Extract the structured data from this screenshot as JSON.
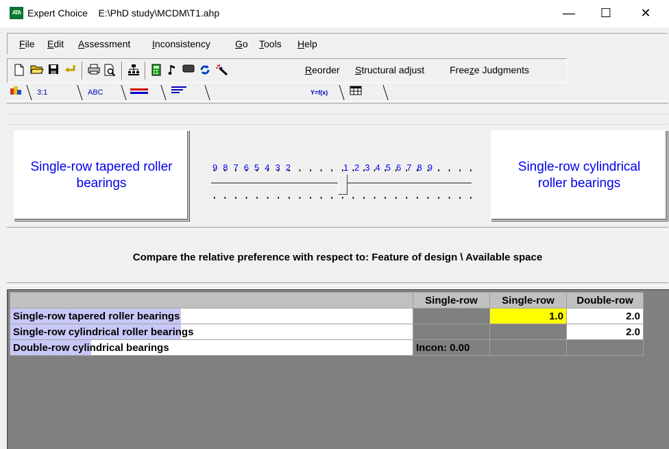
{
  "window": {
    "app_icon_text": "ATA",
    "title": "Expert Choice    E:\\PhD study\\MCDM\\T1.ahp",
    "minimize": "—",
    "maximize": "☐",
    "close": "✕"
  },
  "menu": {
    "file": {
      "key": "F",
      "rest": "ile"
    },
    "edit": {
      "key": "E",
      "rest": "dit"
    },
    "assessment": {
      "key": "A",
      "rest": "ssessment"
    },
    "inconsistency": {
      "key": "I",
      "rest": "nconsistency"
    },
    "go": {
      "key": "G",
      "rest": "o"
    },
    "tools": {
      "key": "T",
      "rest": "ools"
    },
    "help": {
      "key": "H",
      "rest": "elp"
    }
  },
  "toolbar": {
    "reorder": {
      "key": "R",
      "rest": "eorder"
    },
    "structural": {
      "key": "S",
      "rest": "tructural adjust"
    },
    "freeze": {
      "pre": "Free",
      "key": "z",
      "rest": "e Judgments"
    }
  },
  "tabs": {
    "pairwise_numeric": "3:1",
    "verbal": "ABC",
    "formula": "Y=f(x)"
  },
  "comparison": {
    "left_item": "Single-row tapered roller bearings",
    "right_item": "Single-row cylindrical roller bearings",
    "scale_left": "9 8 7 6 5 4 3 2",
    "scale_center": "1",
    "scale_right": "2 3 4 5 6 7 8 9",
    "slider_value": 1,
    "instruction": "Compare the relative preference  with respect to: Feature of design  \\ Available space"
  },
  "matrix": {
    "col_headers": [
      "Single-row",
      "Single-row",
      "Double-row"
    ],
    "rows": [
      {
        "label": "Single-row tapered roller bearings",
        "cells": [
          "",
          "1.0",
          "2.0"
        ]
      },
      {
        "label": "Single-row cylindrical roller bearings",
        "cells": [
          "",
          "",
          "2.0"
        ]
      },
      {
        "label": "Double-row cylindrical bearings",
        "cells": [
          "Incon: 0.00",
          "",
          ""
        ]
      }
    ]
  },
  "colors": {
    "highlight": "#ffff00",
    "label_highlight": "#c8c8f8",
    "item_text": "#0000ee"
  }
}
